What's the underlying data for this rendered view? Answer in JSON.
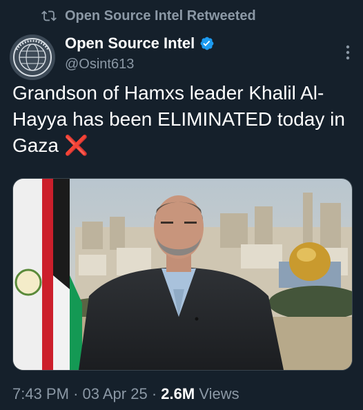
{
  "retweet": {
    "icon": "retweet-icon",
    "text": "Open Source Intel Retweeted"
  },
  "author": {
    "display_name": "Open Source Intel",
    "handle": "@Osint613",
    "verified": true,
    "verified_color": "#1d9bf0",
    "avatar_icon": "globe-logo-icon"
  },
  "tweet": {
    "text": "Grandson of Hamxs leader Khalil Al-Hayya has been ELIMINATED today in Gaza",
    "emoji": "❌",
    "emoji_color": "#e3242b"
  },
  "media": {
    "description_icon": "photo-man-in-suit-with-flags-and-dome"
  },
  "meta": {
    "time": "7:43 PM",
    "date": "03 Apr 25",
    "views_count": "2.6M",
    "views_label": "Views",
    "separator": "·"
  },
  "colors": {
    "background": "#15202b",
    "secondary_text": "#8b98a5",
    "primary_text": "#ffffff"
  }
}
